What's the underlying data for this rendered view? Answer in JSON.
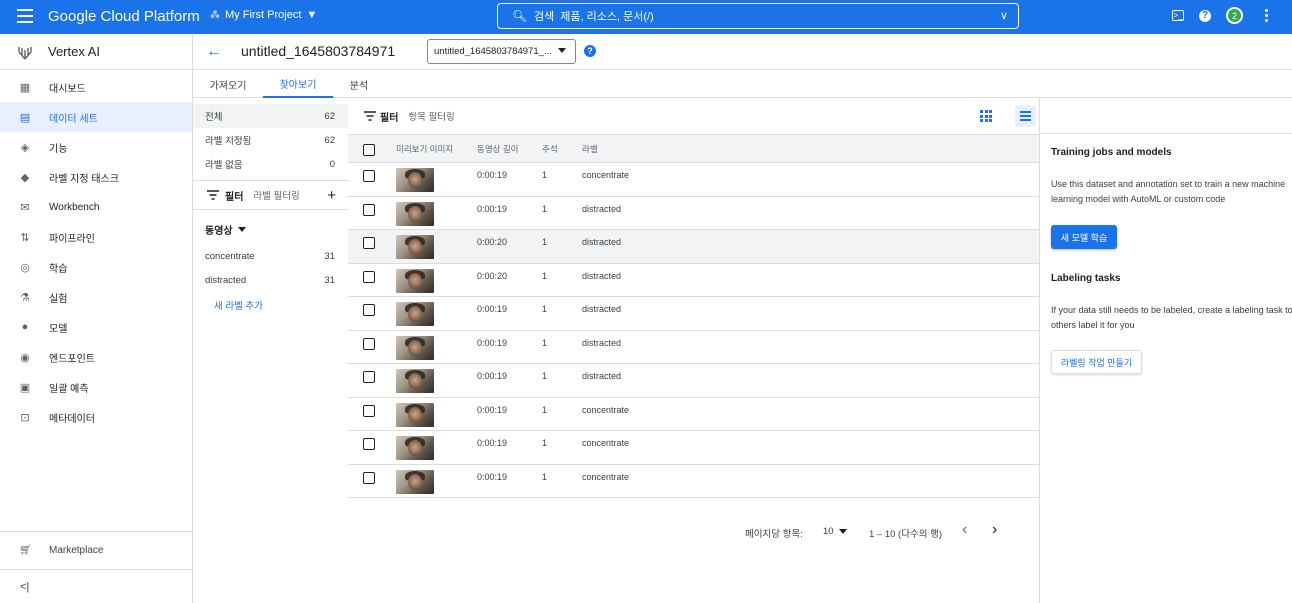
{
  "topbar": {
    "brand": "Google Cloud Platform",
    "project": "My First Project",
    "search_label": "검색",
    "search_hint": "제품, 리소스, 문서(/)",
    "notification_count": "2",
    "colors": {
      "bar": "#1a73e8",
      "badge": "#34a853"
    }
  },
  "nav": {
    "title": "Vertex AI",
    "items": [
      {
        "label": "대시보드",
        "icon": "dashboard-icon"
      },
      {
        "label": "데이터 세트",
        "icon": "dataset-icon",
        "active": true
      },
      {
        "label": "기능",
        "icon": "feature-icon"
      },
      {
        "label": "라벨 지정 태스크",
        "icon": "label-icon"
      },
      {
        "label": "Workbench",
        "icon": "workbench-icon"
      },
      {
        "label": "파이프라인",
        "icon": "pipeline-icon"
      },
      {
        "label": "학습",
        "icon": "training-icon"
      },
      {
        "label": "실험",
        "icon": "experiment-icon"
      },
      {
        "label": "모델",
        "icon": "model-icon"
      },
      {
        "label": "엔드포인트",
        "icon": "endpoint-icon"
      },
      {
        "label": "일괄 예측",
        "icon": "batch-icon"
      },
      {
        "label": "메타데이터",
        "icon": "metadata-icon"
      }
    ],
    "marketplace": "Marketplace",
    "collapse_icon": "<|"
  },
  "header": {
    "title": "untitled_1645803784971",
    "selector_value": "untitled_1645803784971_..."
  },
  "tabs": [
    "가져오기",
    "찾아보기",
    "분석"
  ],
  "facet": {
    "stats": [
      {
        "label": "전체",
        "count": "62"
      },
      {
        "label": "라벨 지정됨",
        "count": "62"
      },
      {
        "label": "라벨 없음",
        "count": "0"
      }
    ],
    "filter_label": "필터",
    "filter_placeholder": "라벨 필터링",
    "group": "동영상",
    "labels": [
      {
        "name": "concentrate",
        "count": "31"
      },
      {
        "name": "distracted",
        "count": "31"
      }
    ],
    "add_label": "새 라벨 추가"
  },
  "table": {
    "filter_label": "필터",
    "filter_placeholder": "항목 필터링",
    "columns": [
      "미리보기 이미지",
      "동영상 길이",
      "주석",
      "라벨"
    ],
    "rows": [
      {
        "duration": "0:00:19",
        "annotations": "1",
        "label": "concentrate"
      },
      {
        "duration": "0:00:19",
        "annotations": "1",
        "label": "distracted"
      },
      {
        "duration": "0:00:20",
        "annotations": "1",
        "label": "distracted"
      },
      {
        "duration": "0:00:20",
        "annotations": "1",
        "label": "distracted"
      },
      {
        "duration": "0:00:19",
        "annotations": "1",
        "label": "distracted"
      },
      {
        "duration": "0:00:19",
        "annotations": "1",
        "label": "distracted"
      },
      {
        "duration": "0:00:19",
        "annotations": "1",
        "label": "distracted"
      },
      {
        "duration": "0:00:19",
        "annotations": "1",
        "label": "concentrate"
      },
      {
        "duration": "0:00:19",
        "annotations": "1",
        "label": "concentrate"
      },
      {
        "duration": "0:00:19",
        "annotations": "1",
        "label": "concentrate"
      }
    ]
  },
  "pager": {
    "per_page_label": "페이지당 항목:",
    "per_page": "10",
    "range": "1 – 10 (다수의 행)"
  },
  "right": {
    "training_title": "Training jobs and models",
    "training_line1": "Use this dataset and annotation set to train a new machine",
    "training_line2": "learning model with AutoML or custom code",
    "train_button": "새 모델 학습",
    "labeling_title": "Labeling tasks",
    "labeling_line1": "If your data still needs to be labeled, create a labeling task to have",
    "labeling_line2": "others label it for you",
    "labeling_button": "라벨링 작업 만들기"
  }
}
